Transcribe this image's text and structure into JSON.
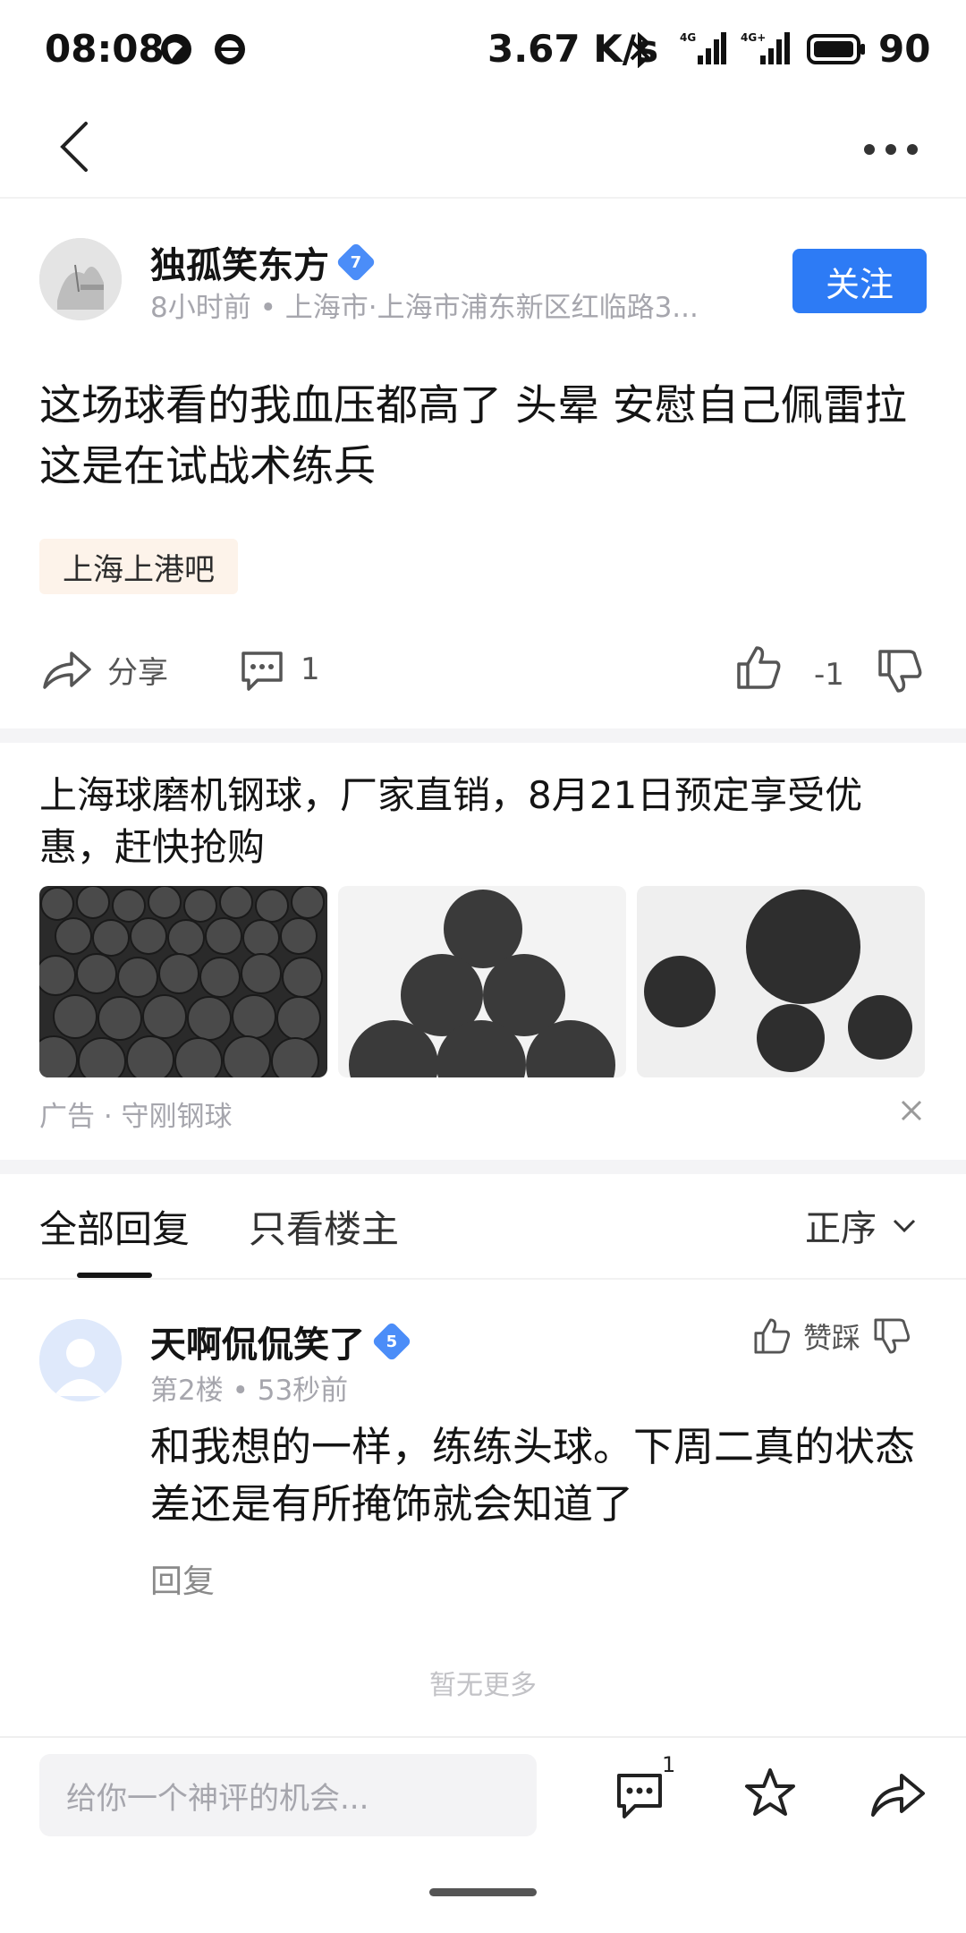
{
  "status_bar": {
    "time": "08:08",
    "speed": "3.67 K/s",
    "battery": "90"
  },
  "post": {
    "author_name": "独孤笑东方",
    "author_level": "7",
    "meta": "8小时前 • 上海市·上海市浦东新区红临路3...",
    "follow_label": "关注",
    "text": "这场球看的我血压都高了 头晕 安慰自己佩雷拉这是在试战术练兵",
    "tag": "上海上港吧",
    "share_label": "分享",
    "comment_count": "1",
    "vote_count": "-1"
  },
  "ad": {
    "title": "上海球磨机钢球，厂家直销，8月21日预定享受优惠，赶快抢购",
    "footer": "广告 · 守刚钢球"
  },
  "replies_header": {
    "tab_all": "全部回复",
    "tab_owner": "只看楼主",
    "sort_label": "正序"
  },
  "comment": {
    "user_name": "天啊侃侃笑了",
    "user_level": "5",
    "meta": "第2楼 • 53秒前",
    "vote_label": "赞踩",
    "text": "和我想的一样，练练头球。下周二真的状态差还是有所掩饰就会知道了",
    "reply_label": "回复"
  },
  "no_more": "暂无更多",
  "bottom_bar": {
    "input_placeholder": "给你一个神评的机会...",
    "comment_badge": "1"
  },
  "colors": {
    "accent": "#2d7bf5",
    "tag_bg": "#fdf3ea"
  }
}
